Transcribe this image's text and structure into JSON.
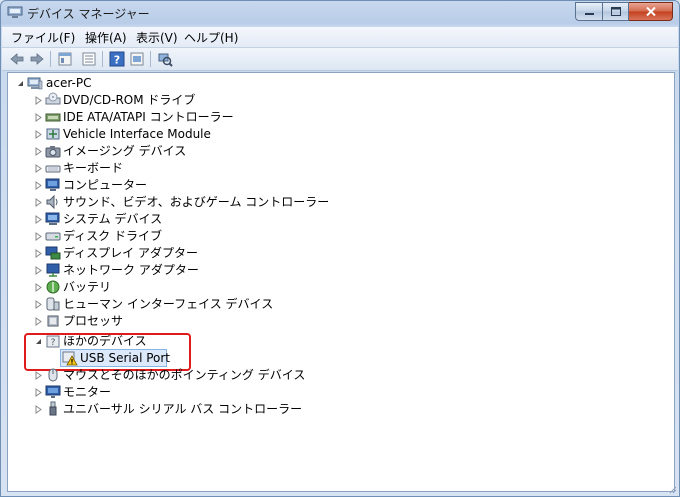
{
  "window": {
    "title": "デバイス マネージャー"
  },
  "menu": {
    "file": "ファイル(F)",
    "action": "操作(A)",
    "view": "表示(V)",
    "help": "ヘルプ(H)"
  },
  "toolbar": {
    "icons": [
      "back-arrow-icon",
      "forward-arrow-icon",
      "properties-icon",
      "device-list-icon",
      "help-icon",
      "view-icon",
      "scan-hardware-icon"
    ]
  },
  "tree": {
    "root": "acer-PC",
    "items": [
      {
        "label": "DVD/CD-ROM ドライブ",
        "icon": "dvd-drive-icon"
      },
      {
        "label": "IDE ATA/ATAPI コントローラー",
        "icon": "ide-controller-icon"
      },
      {
        "label": "Vehicle Interface Module",
        "icon": "vehicle-module-icon"
      },
      {
        "label": "イメージング デバイス",
        "icon": "camera-icon"
      },
      {
        "label": "キーボード",
        "icon": "keyboard-icon"
      },
      {
        "label": "コンピューター",
        "icon": "computer-icon"
      },
      {
        "label": "サウンド、ビデオ、およびゲーム コントローラー",
        "icon": "speaker-icon"
      },
      {
        "label": "システム デバイス",
        "icon": "system-device-icon"
      },
      {
        "label": "ディスク ドライブ",
        "icon": "disk-drive-icon"
      },
      {
        "label": "ディスプレイ アダプター",
        "icon": "display-adapter-icon"
      },
      {
        "label": "ネットワーク アダプター",
        "icon": "network-adapter-icon"
      },
      {
        "label": "バッテリ",
        "icon": "battery-icon"
      },
      {
        "label": "ヒューマン インターフェイス デバイス",
        "icon": "hid-icon"
      },
      {
        "label": "プロセッサ",
        "icon": "processor-icon"
      },
      {
        "label": "ほかのデバイス",
        "icon": "other-devices-icon"
      },
      {
        "label": "USB Serial Port",
        "icon": "warning-device-icon"
      },
      {
        "label": "マウスとそのほかのポインティング デバイス",
        "icon": "mouse-icon"
      },
      {
        "label": "モニター",
        "icon": "monitor-icon"
      },
      {
        "label": "ユニバーサル シリアル バス コントローラー",
        "icon": "usb-icon"
      }
    ]
  },
  "colors": {
    "highlight": "#e01b1b",
    "selection": "#dbe9fa",
    "titlebar": "#c7d8ee"
  }
}
